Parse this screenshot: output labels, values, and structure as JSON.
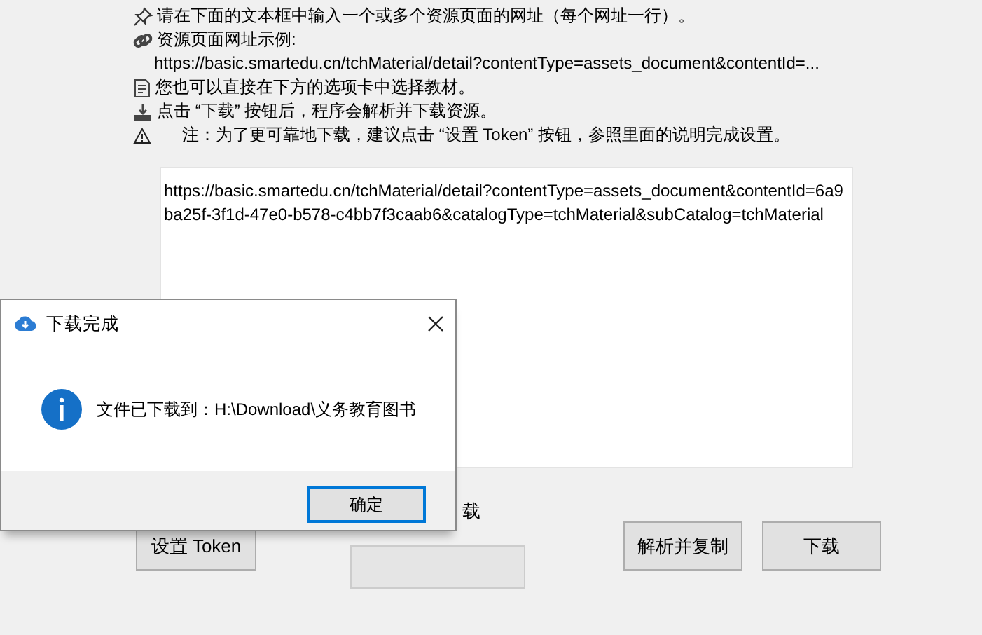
{
  "instructions": [
    {
      "kind": "pin",
      "text": "请在下面的文本框中输入一个或多个资源页面的网址（每个网址一行）。"
    },
    {
      "kind": "link",
      "text": "资源页面网址示例:"
    },
    {
      "kind": "indent",
      "text": "https://basic.smartedu.cn/tchMaterial/detail?contentType=assets_document&contentId=..."
    },
    {
      "kind": "doc",
      "text": "您也可以直接在下方的选项卡中选择教材。"
    },
    {
      "kind": "download",
      "text": "点击 “下载” 按钮后，程序会解析并下载资源。"
    },
    {
      "kind": "warning",
      "text": "注：为了更可靠地下载，建议点击 “设置 Token” 按钮，参照里面的说明完成设置。"
    }
  ],
  "url_box": {
    "value": "https://basic.smartedu.cn/tchMaterial/detail?contentType=assets_document&contentId=6a9ba25f-3f1d-47e0-b578-c4bb7f3caab6&catalogType=tchMaterial&subCatalog=tchMaterial"
  },
  "token_button": "设置 Token",
  "partial_label": "载",
  "buttons": [
    "解析并复制",
    "下载"
  ],
  "dialog": {
    "title": "下载完成",
    "message": "文件已下载到：H:\\Download\\义务教育图书",
    "ok_button": "确定"
  }
}
